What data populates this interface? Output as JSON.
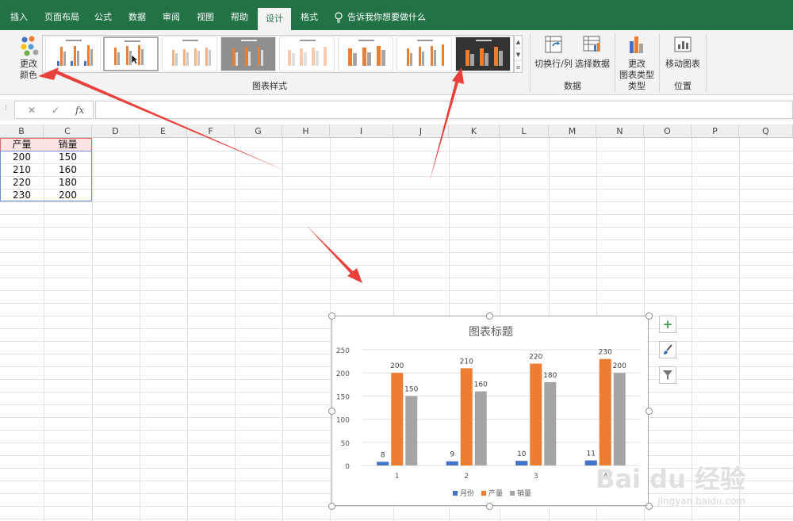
{
  "ribbon_tabs": [
    "插入",
    "页面布局",
    "公式",
    "数据",
    "审阅",
    "视图",
    "帮助",
    "设计",
    "格式"
  ],
  "active_tab": "设计",
  "tell_me": "告诉我你想要做什么",
  "ribbon": {
    "change_colors_line1": "更改",
    "change_colors_line2": "颜色",
    "chart_styles_group": "图表样式",
    "switch_row_col": "切换行/列",
    "select_data": "选择数据",
    "data_group": "数据",
    "change_chart_type_line1": "更改",
    "change_chart_type_line2": "图表类型",
    "type_group": "类型",
    "move_chart": "移动图表",
    "location_group": "位置"
  },
  "formula_bar": {
    "cancel": "✕",
    "enter": "✓",
    "fx": "fx",
    "value": ""
  },
  "columns": [
    "B",
    "C",
    "D",
    "E",
    "F",
    "G",
    "H",
    "I",
    "J",
    "K",
    "L",
    "M",
    "N",
    "O",
    "P",
    "Q"
  ],
  "table": {
    "headers": [
      "产量",
      "销量"
    ],
    "rows": [
      [
        "200",
        "150"
      ],
      [
        "210",
        "160"
      ],
      [
        "220",
        "180"
      ],
      [
        "230",
        "200"
      ]
    ]
  },
  "chart_data": {
    "type": "bar",
    "title": "图表标题",
    "categories": [
      "1",
      "2",
      "3",
      "4"
    ],
    "ylim": [
      0,
      250
    ],
    "yticks": [
      "0",
      "50",
      "100",
      "150",
      "200",
      "250"
    ],
    "grid": true,
    "legend": "bottom",
    "series": [
      {
        "name": "月份",
        "values": [
          8,
          9,
          10,
          11
        ],
        "color": "#4472c4"
      },
      {
        "name": "产量",
        "values": [
          200,
          210,
          220,
          230
        ],
        "color": "#ed7d31"
      },
      {
        "name": "销量",
        "values": [
          150,
          160,
          180,
          200
        ],
        "color": "#a5a5a5"
      }
    ]
  },
  "chart_tools": {
    "add_element": "+",
    "styles_icon": "brush-icon",
    "filter_icon": "filter-icon"
  },
  "watermark": {
    "brand": "Bai du 经验",
    "url": "jingyan.baidu.com"
  },
  "colors": {
    "excel_green": "#217346",
    "arrow_red": "#e8413c"
  }
}
